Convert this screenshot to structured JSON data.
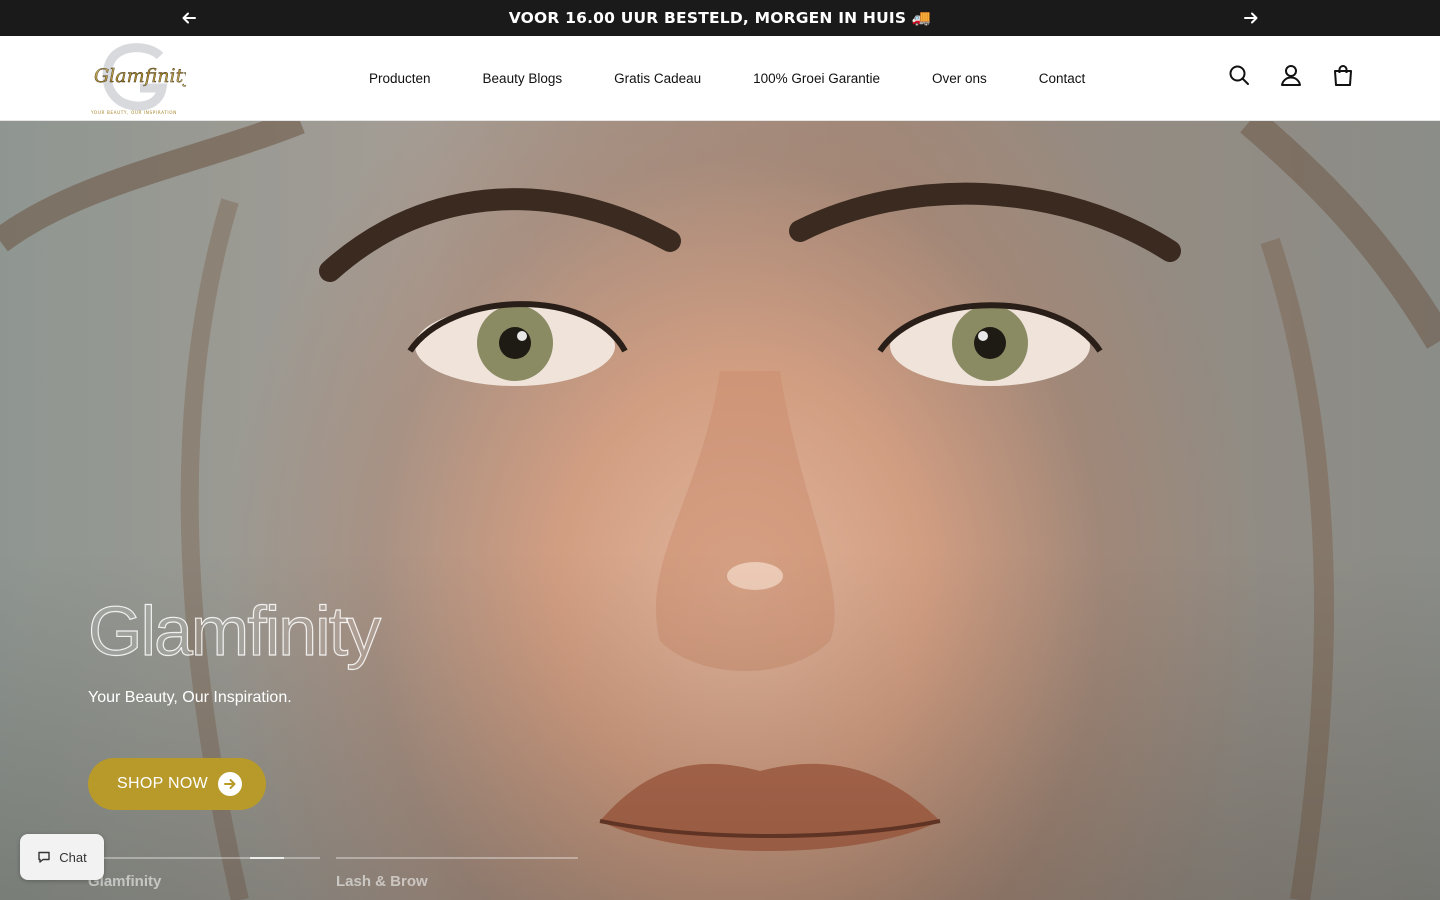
{
  "announcement": {
    "text": "VOOR 16.00 UUR BESTELD, MORGEN IN HUIS 🚚"
  },
  "brand": {
    "logo_text": "Glamfinity",
    "logo_tagline": "YOUR BEAUTY, OUR INSPIRATION",
    "accent_color": "#b89a2a"
  },
  "nav": {
    "items": [
      {
        "label": "Producten"
      },
      {
        "label": "Beauty Blogs"
      },
      {
        "label": "Gratis Cadeau"
      },
      {
        "label": "100% Groei Garantie"
      },
      {
        "label": "Over ons"
      },
      {
        "label": "Contact"
      }
    ]
  },
  "header_icons": [
    "search-icon",
    "account-icon",
    "cart-icon"
  ],
  "hero": {
    "title": "Glamfinity",
    "subtitle": "Your Beauty, Our Inspiration.",
    "cta_label": "SHOP NOW",
    "slides": [
      {
        "label": "Glamfinity"
      },
      {
        "label": "Lash & Brow"
      }
    ]
  },
  "chat": {
    "label": "Chat"
  }
}
